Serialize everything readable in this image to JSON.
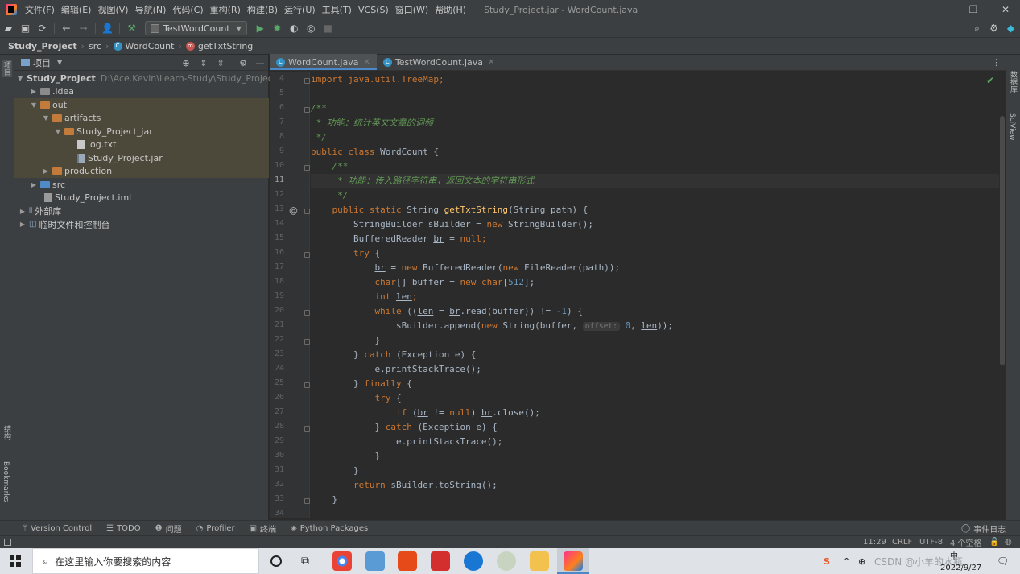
{
  "app": {
    "menu": [
      "文件(F)",
      "编辑(E)",
      "视图(V)",
      "导航(N)",
      "代码(C)",
      "重构(R)",
      "构建(B)",
      "运行(U)",
      "工具(T)",
      "VCS(S)",
      "窗口(W)",
      "帮助(H)"
    ],
    "window_title": "Study_Project.jar - WordCount.java"
  },
  "toolbar": {
    "run_config": "TestWordCount"
  },
  "breadcrumb": {
    "project": "Study_Project",
    "folder": "src",
    "class": "WordCount",
    "method": "getTxtString"
  },
  "project_panel": {
    "title": "项目",
    "root_name": "Study_Project",
    "root_path": "D:\\Ace.Kevin\\Learn-Study\\Study_Project",
    "items": [
      {
        "label": ".idea"
      },
      {
        "label": "out"
      },
      {
        "label": "artifacts"
      },
      {
        "label": "Study_Project_jar"
      },
      {
        "label": "log.txt"
      },
      {
        "label": "Study_Project.jar"
      },
      {
        "label": "production"
      },
      {
        "label": "src"
      },
      {
        "label": "Study_Project.iml"
      },
      {
        "label": "外部库"
      },
      {
        "label": "临时文件和控制台"
      }
    ]
  },
  "left_stripe": {
    "top_label": "项目",
    "structure_label": "结构",
    "bookmarks_label": "Bookmarks"
  },
  "right_stripe": {
    "db_label": "数据库",
    "sciview_label": "SciView"
  },
  "editor": {
    "tabs": [
      {
        "label": "WordCount.java",
        "active": true
      },
      {
        "label": "TestWordCount.java",
        "active": false
      }
    ],
    "line_numbers": [
      "4",
      "5",
      "6",
      "7",
      "8",
      "9",
      "10",
      "11",
      "12",
      "13",
      "14",
      "15",
      "16",
      "17",
      "18",
      "19",
      "20",
      "21",
      "22",
      "23",
      "24",
      "25",
      "26",
      "27",
      "28",
      "29",
      "30",
      "31",
      "32",
      "33",
      "34"
    ],
    "code": {
      "l4": "import java.util.TreeMap;",
      "l6": "/**",
      "l7": " * 功能：统计英文文章的词频",
      "l8": " */",
      "l9a": "public class ",
      "l9b": "WordCount {",
      "l10": "    /**",
      "l11": "     * 功能：传入路径字符串，返回文本的字符串形式",
      "l12": "     */",
      "l13a": "    public static ",
      "l13b": "String ",
      "l13c": "getTxtString",
      "l13d": "(String path) {",
      "l14a": "        StringBuilder sBuilder = ",
      "l14b": "new ",
      "l14c": "StringBuilder();",
      "l15a": "        BufferedReader ",
      "l15b": "br",
      "l15c": " = ",
      "l15d": "null",
      "l15e": ";",
      "l16a": "        try ",
      "l16b": "{",
      "l17a": "            ",
      "l17b": "br",
      "l17c": " = ",
      "l17d": "new ",
      "l17e": "BufferedReader(",
      "l17f": "new ",
      "l17g": "FileReader(path));",
      "l18a": "            ",
      "l18b": "char",
      "l18c": "[] buffer = ",
      "l18d": "new char",
      "l18e": "[",
      "l18f": "512",
      "l18g": "];",
      "l19a": "            ",
      "l19b": "int ",
      "l19c": "len",
      "l19d": ";",
      "l20a": "            ",
      "l20b": "while ",
      "l20c": "((",
      "l20d": "len",
      "l20e": " = ",
      "l20f": "br",
      "l20g": ".read(buffer)) != ",
      "l20h": "-1",
      "l20i": ") {",
      "l21a": "                sBuilder.append(",
      "l21b": "new ",
      "l21c": "String(buffer, ",
      "l21hint": "offset:",
      "l21d": " ",
      "l21e": "0",
      "l21f": ", ",
      "l21g": "len",
      "l21h": "));",
      "l22": "            }",
      "l23a": "        } ",
      "l23b": "catch ",
      "l23c": "(Exception e) {",
      "l24": "            e.printStackTrace();",
      "l25a": "        } ",
      "l25b": "finally ",
      "l25c": "{",
      "l26a": "            ",
      "l26b": "try ",
      "l26c": "{",
      "l27a": "                ",
      "l27b": "if ",
      "l27c": "(",
      "l27d": "br",
      "l27e": " != ",
      "l27f": "null",
      "l27g": ") ",
      "l27h": "br",
      "l27i": ".close();",
      "l28a": "            } ",
      "l28b": "catch ",
      "l28c": "(Exception e) {",
      "l29": "                e.printStackTrace();",
      "l30": "            }",
      "l31": "        }",
      "l32a": "        ",
      "l32b": "return ",
      "l32c": "sBuilder.toString();",
      "l33": "    }"
    }
  },
  "tool_windows": {
    "version_control": "Version Control",
    "todo": "TODO",
    "problems": "问题",
    "profiler": "Profiler",
    "terminal": "终端",
    "python_packages": "Python Packages",
    "event_log": "事件日志"
  },
  "status_bar": {
    "position": "11:29",
    "line_sep": "CRLF",
    "encoding": "UTF-8",
    "indent": "4 个空格"
  },
  "taskbar": {
    "search_placeholder": "在这里输入你要搜索的内容",
    "tray_text": "CSDN @小羊的水瓶",
    "date": "2022/9/27",
    "ime": "中"
  },
  "colors": {
    "keyword": "#cc7832",
    "comment": "#629755",
    "number": "#6897bb",
    "function": "#ffc66d",
    "text": "#a9b7c6",
    "editor_bg": "#2b2b2b",
    "panel_bg": "#3c3f41",
    "selection_bg": "#4d493a"
  }
}
